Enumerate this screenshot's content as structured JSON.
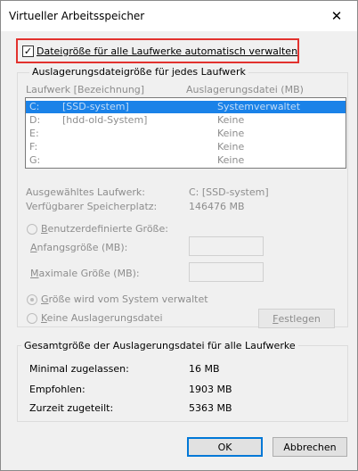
{
  "window": {
    "title": "Virtueller Arbeitsspeicher",
    "close_glyph": "✕"
  },
  "auto_manage": {
    "checked_glyph": "✓",
    "label": "Dateigröße für alle Laufwerke automatisch verwalten"
  },
  "paging_group": {
    "legend": "Auslagerungsdateigröße für jedes Laufwerk",
    "col_drive": "Laufwerk [Bezeichnung]",
    "col_file": "Auslagerungsdatei (MB)",
    "rows": [
      {
        "drive": "C:",
        "label": "[SSD-system]",
        "file": "Systemverwaltet"
      },
      {
        "drive": "D:",
        "label": "[hdd-old-System]",
        "file": "Keine"
      },
      {
        "drive": "E:",
        "label": "",
        "file": "Keine"
      },
      {
        "drive": "F:",
        "label": "",
        "file": "Keine"
      },
      {
        "drive": "G:",
        "label": "",
        "file": "Keine"
      }
    ],
    "selected_drive_label": "Ausgewähltes Laufwerk:",
    "selected_drive_value": "C:  [SSD-system]",
    "free_space_label": "Verfügbarer Speicherplatz:",
    "free_space_value": "146476 MB",
    "custom_size": {
      "b": "B",
      "rest": "enutzerdefinierte Größe:"
    },
    "initial_size": {
      "a": "A",
      "rest": "nfangsgröße (MB):"
    },
    "max_size": {
      "a": "M",
      "rest": "aximale Größe (MB):"
    },
    "system_managed": {
      "a": "G",
      "rest": "röße wird vom System verwaltet"
    },
    "no_paging": {
      "a": "K",
      "rest": "eine Auslagerungsdatei"
    },
    "set_button": {
      "a": "F",
      "rest": "estlegen"
    }
  },
  "total_group": {
    "legend": "Gesamtgröße der Auslagerungsdatei für alle Laufwerke",
    "min_label": "Minimal zugelassen:",
    "min_value": "16 MB",
    "recommended_label": "Empfohlen:",
    "recommended_value": "1903 MB",
    "allocated_label": "Zurzeit zugeteilt:",
    "allocated_value": "5363 MB"
  },
  "buttons": {
    "ok": "OK",
    "cancel": "Abbrechen"
  }
}
